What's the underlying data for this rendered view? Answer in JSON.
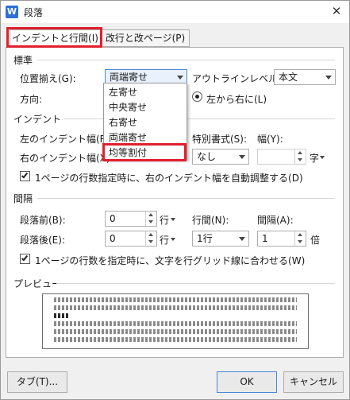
{
  "window": {
    "title": "段落",
    "app_icon_letter": "W",
    "close_glyph": "✕"
  },
  "tabs": [
    {
      "label": "インデントと行間(I)"
    },
    {
      "label": "改行と改ページ(P)"
    }
  ],
  "general": {
    "section": "標準",
    "alignment_label": "位置揃え(G):",
    "alignment_value": "両端寄せ",
    "outline_label": "アウトラインレベル(O):",
    "outline_value": "本文",
    "direction_label": "方向:",
    "direction_option": "左から右に(L)"
  },
  "alignment_dropdown": {
    "items": [
      "左寄せ",
      "中央寄せ",
      "右寄せ",
      "両端寄せ",
      "均等割付"
    ]
  },
  "indent": {
    "section": "インデント",
    "left_label": "左のインデント幅(R):",
    "right_label": "右のインデント幅(X):",
    "special_label": "特別書式(S):",
    "special_value": "なし",
    "by_label": "幅(Y):",
    "by_unit": "字",
    "auto_adjust_label": "1ページの行数指定時に、右のインデント幅を自動調整する(D)"
  },
  "spacing": {
    "section": "間隔",
    "before_label": "段落前(B):",
    "before_value": "0",
    "before_unit": "行",
    "after_label": "段落後(E):",
    "after_value": "0",
    "after_unit": "行",
    "line_spacing_label": "行間(N):",
    "line_spacing_value": "1行",
    "at_label": "間隔(A):",
    "at_value": "1",
    "at_unit": "倍",
    "snap_grid_label": "1ページの行数を指定時に、文字を行グリッド線に合わせる(W)"
  },
  "preview": {
    "section": "プレビュー"
  },
  "buttons": {
    "tabs": "タブ(T)...",
    "ok": "OK",
    "cancel": "キャンセル"
  }
}
